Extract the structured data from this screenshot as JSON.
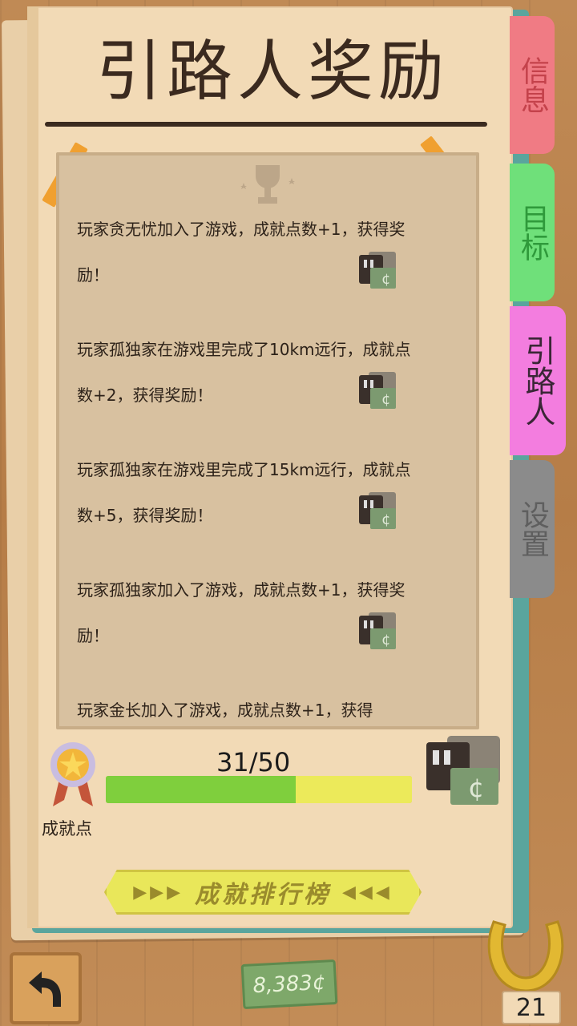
{
  "title": "引路人奖励",
  "tabs": {
    "info": "信息",
    "goal": "目标",
    "guide": "引路人",
    "settings": "设置"
  },
  "messages": [
    {
      "text": "玩家贪无忧加入了游戏，成就点数+1，获得奖励！"
    },
    {
      "text": "玩家孤独家在游戏里完成了10km远行，成就点数+2，获得奖励！"
    },
    {
      "text": "玩家孤独家在游戏里完成了15km远行，成就点数+5，获得奖励！"
    },
    {
      "text": "玩家孤独家加入了游戏，成就点数+1，获得奖励！"
    },
    {
      "text": "玩家金长加入了游戏，成就点数+1，获得"
    }
  ],
  "progress": {
    "label": "31/50",
    "fraction": 0.62
  },
  "achievement_label": "成就点",
  "leaderboard_button": "成就排行榜",
  "money": "8,383¢",
  "level": "21",
  "colors": {
    "tab_info": "#f07b84",
    "tab_goal": "#6fe07a",
    "tab_guide": "#f37ddf",
    "tab_settings": "#8b8b8b",
    "progress_fill": "#7fcf3d",
    "progress_rest": "#ecea5a"
  }
}
